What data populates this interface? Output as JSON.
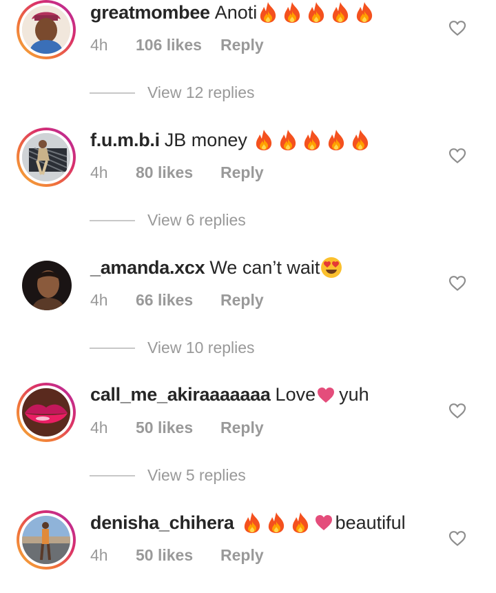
{
  "comments": [
    {
      "username": "greatmombee",
      "text": "Anoti",
      "time": "4h",
      "likes": "106 likes",
      "reply": "Reply",
      "view_replies": "View 12 replies",
      "avatar_desc": "woman-with-headwrap"
    },
    {
      "username": "f.u.m.b.i",
      "text": "JB money",
      "time": "4h",
      "likes": "80 likes",
      "reply": "Reply",
      "view_replies": "View 6 replies",
      "avatar_desc": "person-posing"
    },
    {
      "username": "_amanda.xcx",
      "text": "We can’t wait",
      "time": "4h",
      "likes": "66 likes",
      "reply": "Reply",
      "view_replies": "View 10 replies",
      "avatar_desc": "portrait"
    },
    {
      "username": "call_me_akiraaaaaaa",
      "text": "Love",
      "text_after": "yuh",
      "time": "4h",
      "likes": "50 likes",
      "reply": "Reply",
      "view_replies": "View 5 replies",
      "avatar_desc": "pink-lips"
    },
    {
      "username": "denisha_chihera",
      "text": "beautiful",
      "time": "4h",
      "likes": "50 likes",
      "reply": "Reply",
      "avatar_desc": "full-body-photo"
    }
  ],
  "icons": {
    "like": "heart-outline-icon",
    "fire": "fire-emoji",
    "heart": "red-heart-emoji",
    "heart_eyes": "heart-eyes-emoji"
  },
  "colors": {
    "username": "#262626",
    "meta": "#999999",
    "story_ring_start": "#f5b33a",
    "story_ring_end": "#b12ba6",
    "heart_emoji": "#e44d7b"
  }
}
